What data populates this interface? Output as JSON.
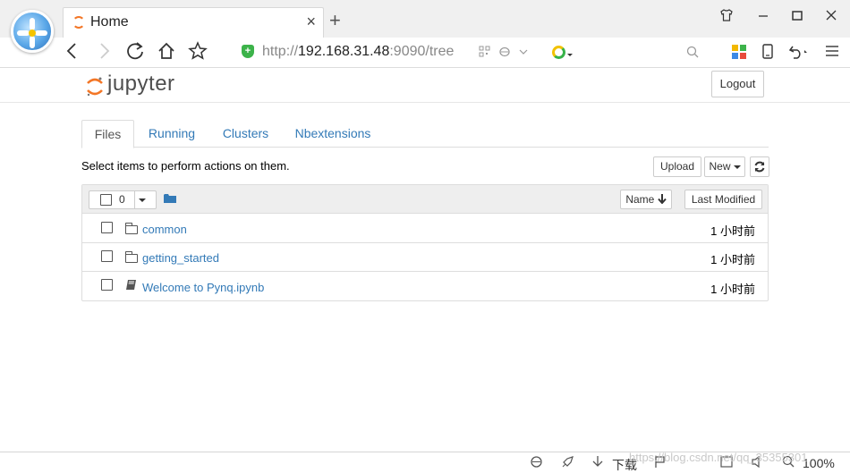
{
  "browser": {
    "tab_title": "Home",
    "tab_close": "×",
    "new_tab": "+",
    "address_prefix": "http://",
    "address_host": "192.168.31.48",
    "address_rest": ":9090/tree",
    "window_controls": [
      "shirt-icon",
      "minimize-icon",
      "maximize-icon",
      "close-icon"
    ]
  },
  "jupyter": {
    "logo_text": "jupyter",
    "logout_label": "Logout",
    "tabs": [
      {
        "label": "Files",
        "active": true
      },
      {
        "label": "Running",
        "active": false
      },
      {
        "label": "Clusters",
        "active": false
      },
      {
        "label": "Nbextensions",
        "active": false
      }
    ],
    "instructions": "Select items to perform actions on them.",
    "upload_label": "Upload",
    "new_label": "New",
    "selected_count": "0",
    "sort_name_label": "Name",
    "sort_name_arrow": "🡓",
    "last_modified_label": "Last Modified",
    "items": [
      {
        "name": "common",
        "type": "folder",
        "modified": "1 小时前"
      },
      {
        "name": "getting_started",
        "type": "folder",
        "modified": "1 小时前"
      },
      {
        "name": "Welcome to Pynq.ipynb",
        "type": "notebook",
        "modified": "1 小时前"
      }
    ]
  },
  "statusbar": {
    "download_label": "下载",
    "zoom": "100%",
    "watermark": "https://blog.csdn.net/qq_35355301"
  },
  "colors": {
    "link": "#337ab7",
    "jupyter_orange": "#f37626",
    "shield_green": "#3cb34a"
  }
}
